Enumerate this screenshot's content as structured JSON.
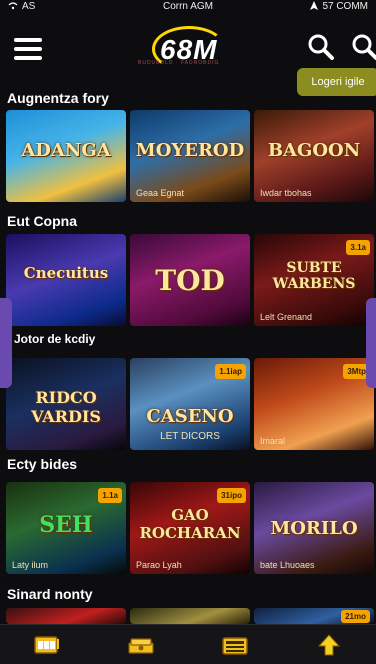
{
  "status_bar": {
    "left": "AS",
    "center": "Corrn AGM",
    "right": "57 COMM"
  },
  "header": {
    "logo_text": "68M",
    "logo_tagline": "BUDUBDLD · FADROBDIG",
    "login_label": "Logeri igile"
  },
  "sections": [
    {
      "title": "Augnentza fory",
      "tiles": [
        {
          "title": "ADANGA",
          "sub": "",
          "badge": ""
        },
        {
          "title": "MOYEROD",
          "sub": "Geaa Egnat",
          "badge": ""
        },
        {
          "title": "BAGOON",
          "sub": "Iwdar tbohas",
          "badge": ""
        }
      ]
    },
    {
      "title": "Eut Copna",
      "tiles": [
        {
          "title": "Cnecuitus",
          "sub": "",
          "badge": ""
        },
        {
          "title": "TOD",
          "sub": "",
          "badge": ""
        },
        {
          "title": "SUBTE WARBENS",
          "sub": "Lelt Grenand",
          "badge": "3.1a"
        }
      ]
    },
    {
      "title": "Jotor de kcdiy",
      "tiles": [
        {
          "title": "RIDCO VARDIS",
          "sub": "",
          "badge": ""
        },
        {
          "title": "CASENO",
          "sub": "LET DICORS",
          "badge": "1.1iap"
        },
        {
          "title": "",
          "sub": "Imaral",
          "badge": "3Mtp"
        }
      ]
    },
    {
      "title": "Ecty bides",
      "tiles": [
        {
          "title": "SEH",
          "sub": "Laty ilum",
          "badge": "1.1a"
        },
        {
          "title": "GAO ROCHARAN",
          "sub": "Parao Lyah",
          "badge": "31ipo"
        },
        {
          "title": "MORILO",
          "sub": "bate Lhuoaes",
          "badge": ""
        }
      ]
    },
    {
      "title": "Sinard nonty",
      "tiles": [
        {
          "title": "",
          "sub": "",
          "badge": ""
        },
        {
          "title": "",
          "sub": "",
          "badge": ""
        },
        {
          "title": "",
          "sub": "",
          "badge": "21mo"
        }
      ]
    }
  ],
  "bottom_nav": [
    {
      "icon": "slot-machine-icon"
    },
    {
      "icon": "cash-stack-icon"
    },
    {
      "icon": "radio-icon"
    },
    {
      "icon": "up-arrow-icon"
    }
  ],
  "colors": {
    "background": "#0d0d10",
    "accent": "#ffd800",
    "login": "#8b8d20",
    "badge": "#f4a300",
    "side_tab": "#6b4ab0"
  }
}
